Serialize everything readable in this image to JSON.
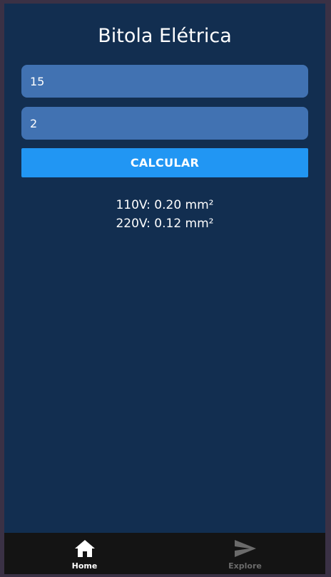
{
  "app": {
    "title": "Bitola Elétrica"
  },
  "form": {
    "field1_value": "15",
    "field2_value": "2",
    "calculate_label": "CALCULAR"
  },
  "results": {
    "line_110": "110V: 0.20 mm²",
    "line_220": "220V: 0.12 mm²"
  },
  "tabs": [
    {
      "label": "Home",
      "icon": "home-icon",
      "active": true
    },
    {
      "label": "Explore",
      "icon": "send-icon",
      "active": false
    }
  ],
  "colors": {
    "background": "#122e50",
    "input": "#4172b2",
    "button": "#2196f3",
    "tabbar": "#141414",
    "tab_active": "#ffffff",
    "tab_inactive": "#6b6b6b"
  }
}
